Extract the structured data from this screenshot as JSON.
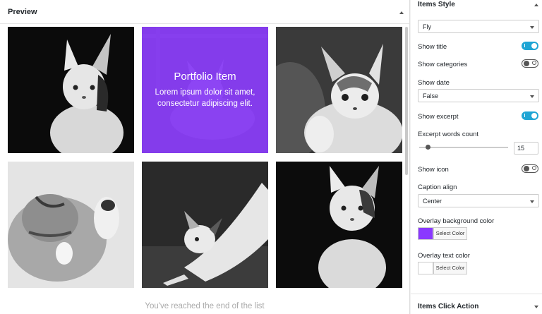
{
  "preview": {
    "title": "Preview",
    "overlay": {
      "title": "Portfolio Item",
      "text": "Lorem ipsum dolor sit amet, consectetur adipiscing elit."
    },
    "end_message": "You've reached the end of the list"
  },
  "sidebar": {
    "title": "Items Style",
    "style_select": "Fly",
    "show_title": {
      "label": "Show title",
      "on": true
    },
    "show_categories": {
      "label": "Show categories",
      "on": false
    },
    "show_date": {
      "label": "Show date",
      "value": "False"
    },
    "show_excerpt": {
      "label": "Show excerpt",
      "on": true
    },
    "excerpt_words": {
      "label": "Excerpt words count",
      "value": "15"
    },
    "show_icon": {
      "label": "Show icon",
      "on": false
    },
    "caption_align": {
      "label": "Caption align",
      "value": "Center"
    },
    "overlay_bg": {
      "label": "Overlay background color",
      "button": "Select Color",
      "color": "#8a38ff"
    },
    "overlay_text": {
      "label": "Overlay text color",
      "button": "Select Color",
      "color": "#ffffff"
    },
    "footer_title": "Items Click Action"
  },
  "colors": {
    "accent": "#1fa5d4",
    "overlay": "#8a38ff"
  }
}
